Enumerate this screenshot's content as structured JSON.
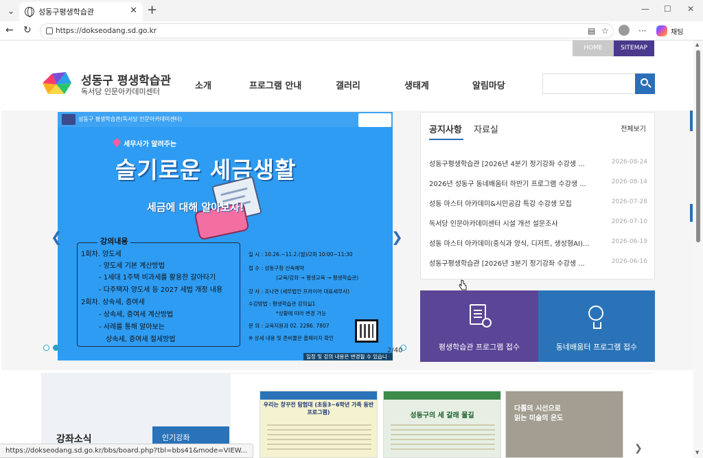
{
  "browser": {
    "tab_title": "성동구평생학습관",
    "url": "https://dokseodang.sd.go.kr",
    "chat_label": "채팅",
    "status_url": "https://dokseodang.sd.go.kr/bbs/board.php?tbl=bbs41&mode=VIEW..."
  },
  "util": {
    "home": "HOME",
    "sitemap": "SITEMAP"
  },
  "logo": {
    "title": "성동구 평생학습관",
    "subtitle": "독서당 인문아카데미센터"
  },
  "gnb": [
    "소개",
    "프로그램 안내",
    "갤러리",
    "생태계",
    "알림마당"
  ],
  "banner": {
    "org": "성동구 평생학습관(독서당 인문아카데미센터)",
    "kicker": "세무사가 알려주는",
    "headline": "슬기로운 세금생활",
    "sub": "세금에 대해 알아보자!",
    "syllabus_title": "강의내용",
    "syllabus": [
      "1회차. 양도세",
      "- 양도세 기본 계산방법",
      "- 1세대 1주택 비과세를 활용한 갈아타기",
      "- 다주택자 양도세 등 2027 세법 개정 내용",
      "2회차. 상속세, 증여세",
      "- 상속세, 증여세 계산방법",
      "- 사례를 통해 알아보는",
      "상속세, 증여세 절세방법"
    ],
    "info": [
      "일 시 : 10.26.~11.2.(월)/2회 10:00~11:30",
      "접 수 : 성동구청 신속예약",
      "(교육/강좌 → 평생교육 → 평생학습관)",
      "강 사 : 조나연 (세무법인 프라이어 대표세무사)",
      "수강방법 : 평생학습관 강의실1",
      "*상황에 따라 변경 가능",
      "문 의 : 교육지원과 02. 2286. 7807",
      "※ 상세 내용 및 준비물은 홈페이지 확인"
    ],
    "note": "일정 및 강의 내용은 변경될 수 있습니다.",
    "counter": "2/40"
  },
  "notice": {
    "tabs": [
      "공지사항",
      "자료실"
    ],
    "more": "전체보기",
    "items": [
      {
        "title": "성동구평생학습관 [2026년 4분기 정기강좌 수강생 ...",
        "date": "2026-08-24"
      },
      {
        "title": "2026년 성동구 동네배움터 하반기 프로그램 수강생 ...",
        "date": "2026-08-14"
      },
      {
        "title": "성동 마스터 아카데미&시민공감 특강 수강생 모집",
        "date": "2026-07-28"
      },
      {
        "title": "독서당 인문아카데미센터 시설 개선 설문조사",
        "date": "2026-07-10"
      },
      {
        "title": "성동 마스터 아카데미(중식과 양식, 디저트, 생성형AI)...",
        "date": "2026-06-19"
      },
      {
        "title": "성동구평생학습관 [2026년 3분기 정기강좌 수강생 ...",
        "date": "2026-06-16"
      }
    ]
  },
  "quick": {
    "a": "평생학습관 프로그램 접수",
    "b": "동네배움터 프로그램 접수"
  },
  "lecture": {
    "title": "강좌소식",
    "tab": "인기강좌"
  },
  "thumbs": {
    "t1": "우리는 창꾸전 탐험대 (초등3~6학년 가족 동반 프로그램)",
    "t2": "성동구의 세 갈래 물길",
    "t3a": "다름의 시선으로",
    "t3b": "읽는 미술의 온도"
  }
}
